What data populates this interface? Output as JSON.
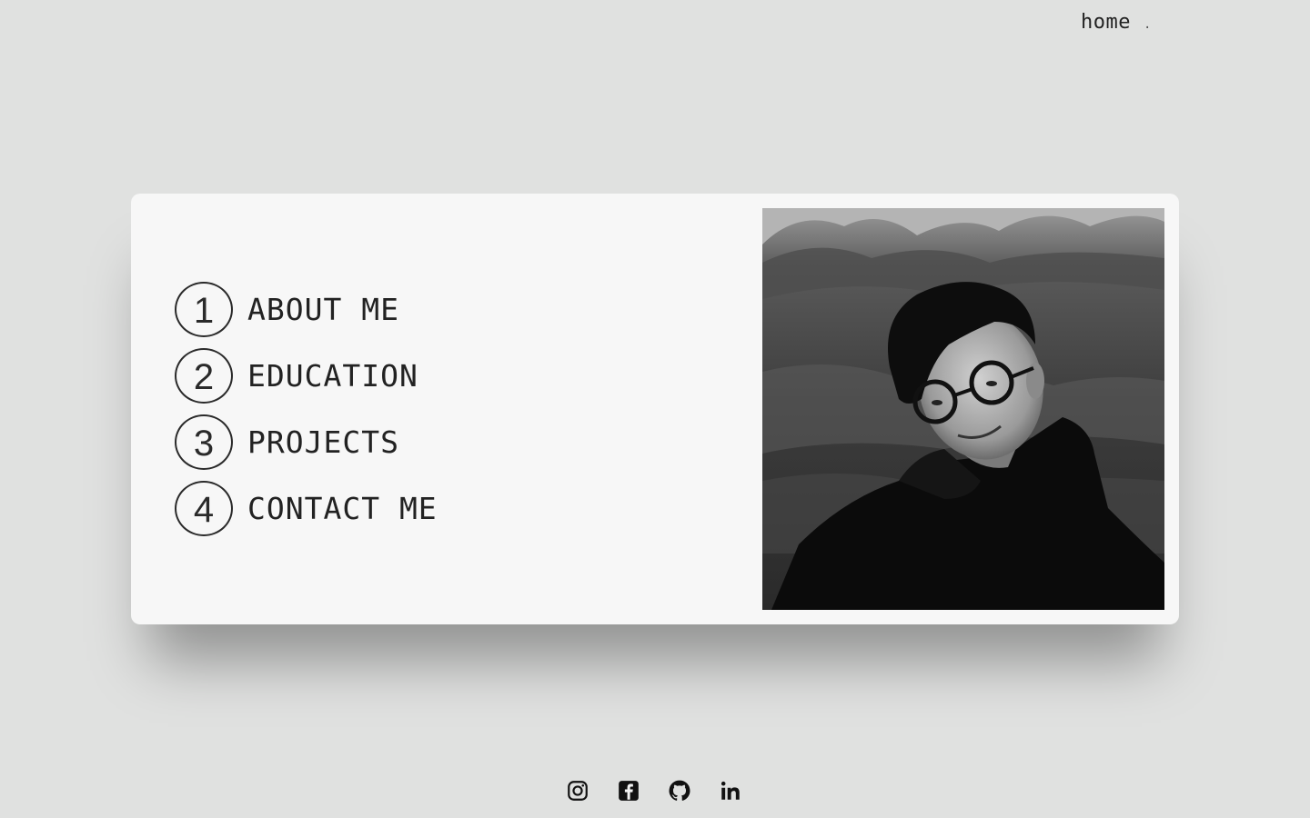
{
  "nav": {
    "home_label": "home",
    "dot": "."
  },
  "menu": {
    "items": [
      {
        "number": "1",
        "label": "ABOUT ME"
      },
      {
        "number": "2",
        "label": "EDUCATION"
      },
      {
        "number": "3",
        "label": "PROJECTS"
      },
      {
        "number": "4",
        "label": "CONTACT ME"
      }
    ]
  },
  "photo": {
    "icon": "portrait-photo",
    "style": "black-and-white"
  },
  "social": {
    "icons": [
      "instagram-icon",
      "facebook-icon",
      "github-icon",
      "linkedin-icon"
    ]
  },
  "colors": {
    "background": "#e0e1e0",
    "card": "#f7f7f7",
    "text": "#222222"
  }
}
